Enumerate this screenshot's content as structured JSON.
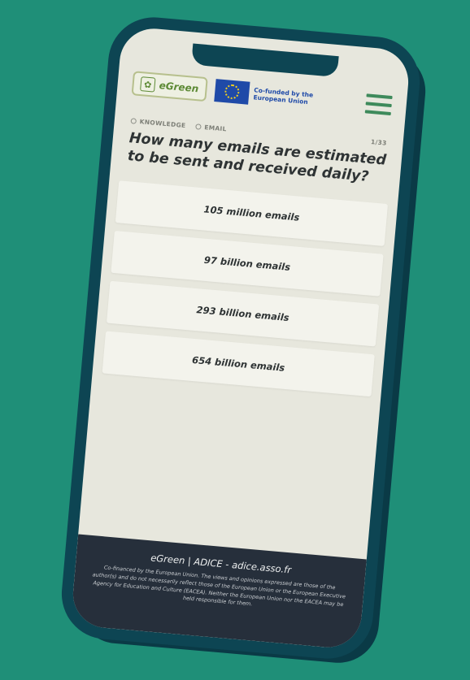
{
  "header": {
    "logo_text": "eGreen",
    "eu_text": "Co-funded by the European Union"
  },
  "breadcrumb": {
    "items": [
      "KNOWLEDGE",
      "EMAIL"
    ],
    "counter": "1/33"
  },
  "question": "How many emails are estimated to be sent and received daily?",
  "answers": [
    "105 million emails",
    "97 billion emails",
    "293 billion emails",
    "654 billion emails"
  ],
  "footer": {
    "title": "eGreen | ADICE - adice.asso.fr",
    "legal": "Co-financed by the European Union. The views and opinions expressed are those of the author(s) and do not necessarily reflect those of the European Union or the European Executive Agency for Education and Culture (EACEA). Neither the European Union nor the EACEA may be held responsible for them."
  },
  "colors": {
    "background": "#1f8f78",
    "phone_frame": "#0d4553",
    "screen": "#e7e7dd",
    "accent_green": "#3e8a5b",
    "eu_blue": "#1f4aa8",
    "footer_bg": "#262f3b"
  },
  "icons": [
    "leaf-icon",
    "eu-flag-icon",
    "hamburger-menu-icon"
  ]
}
